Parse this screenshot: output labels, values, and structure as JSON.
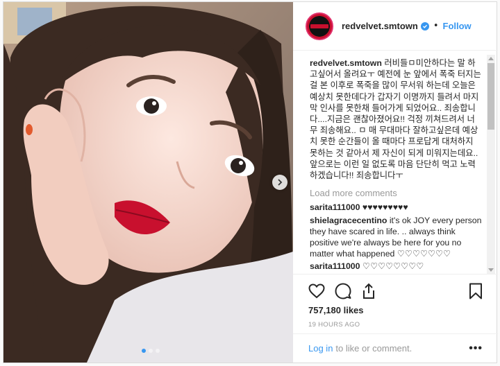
{
  "post": {
    "username": "redvelvet.smtown",
    "follow_label": "Follow",
    "separator": "•",
    "caption_user": "redvelvet.smtown",
    "caption_text": "러비들ㅁ미안하다는 말 하고싶어서 올려요ㅜ 예전에 눈 앞에서 폭죽 터지는 걸 본 이후로 폭죽을 많이 무서워 하는데 오늘은 예상치 못한데다가 갑자기 이명까지 들려서 마지막 인사를 못한채 들어가게 되었어요.. 죄송합니다....지금은 괜찮아졌어요!! 걱정 끼쳐드려서 너무 죄송해요.. ㅁ 매 무대마다 잘하고싶은데 예상치 못한 순간들이 올 때마다 프로답게 대처하지 못하는 것 같아서 제 자신이 되게 미워지는데요.. 앞으로는 이런 일 없도록 마음 단단히 먹고 노력하겠습니다!! 죄송합니다ㅜ",
    "load_more": "Load more comments",
    "comments": [
      {
        "user": "sarita111000",
        "text": "♥♥♥♥♥♥♥♥♥"
      },
      {
        "user": "shielagracecentino",
        "text": "it's ok JOY every person they have scared in life. .. always think positive we're always be here for you no matter what happened ♡♡♡♡♡♡♡"
      },
      {
        "user": "sarita111000",
        "text": "♡♡♡♡♡♡♡♡"
      }
    ],
    "likes": "757,180 likes",
    "time": "19 HOURS AGO",
    "login_link": "Log in",
    "login_suffix": "to like or comment.",
    "more_label": "•••"
  },
  "carousel": {
    "total": 3,
    "active": 1
  },
  "icons": {
    "verified": "verified-badge-icon",
    "next": "chevron-right-icon",
    "like": "heart-icon",
    "comment": "comment-bubble-icon",
    "share": "share-icon",
    "save": "bookmark-icon"
  },
  "colors": {
    "accent": "#3897f0",
    "border": "#dbdbdb",
    "muted": "#999999"
  }
}
